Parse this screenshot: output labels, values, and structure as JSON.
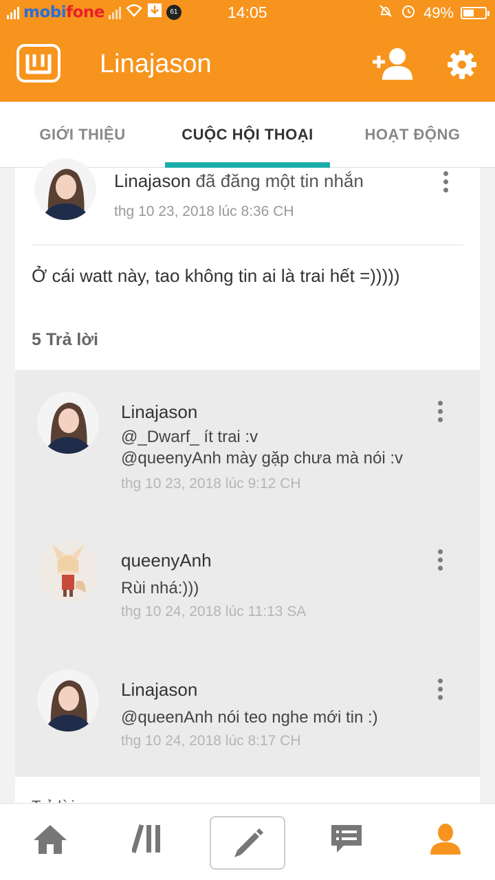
{
  "status_bar": {
    "carrier_a": "mobi",
    "carrier_b": "fone",
    "badge": "61",
    "time": "14:05",
    "battery": "49%",
    "battery_level": 0.49
  },
  "app_bar": {
    "title": "Linajason",
    "logo_icon": "wattpad-logo",
    "add_user_icon": "add-user-icon",
    "settings_icon": "gear-icon",
    "accent_color": "#f7941d"
  },
  "tabs": [
    {
      "label": "GIỚI THIỆU"
    },
    {
      "label": "CUỘC HỘI THOẠI"
    },
    {
      "label": "HOẠT ĐỘNG"
    }
  ],
  "active_tab_color": "#1aaeaa",
  "post": {
    "author": "Linajason",
    "action": "đã đăng một tin nhắn",
    "time": "thg 10 23, 2018 lúc 8:36 CH",
    "body": "Ở cái watt này, tao không tin ai là trai hết =)))))",
    "reply_count": "5 Trả lời"
  },
  "replies": [
    {
      "author": "Linajason",
      "lines": [
        "@_Dwarf_ ít trai :v",
        "@queenyAnh mày gặp chưa mà nói :v"
      ],
      "time": "thg 10 23, 2018 lúc 9:12 CH"
    },
    {
      "author": "queenyAnh",
      "lines": [
        "Rùi nhá:)))"
      ],
      "time": "thg 10 24, 2018 lúc 11:13 SA"
    },
    {
      "author": "Linajason",
      "lines": [
        "@queenAnh nói teo nghe mới tin :)"
      ],
      "time": "thg 10 24, 2018 lúc 8:17 CH"
    }
  ],
  "reply_input_hint": "Trả lời",
  "bottom_nav": [
    {
      "icon": "home-icon"
    },
    {
      "icon": "library-icon"
    },
    {
      "icon": "pencil-icon"
    },
    {
      "icon": "messages-icon"
    },
    {
      "icon": "profile-icon"
    }
  ]
}
